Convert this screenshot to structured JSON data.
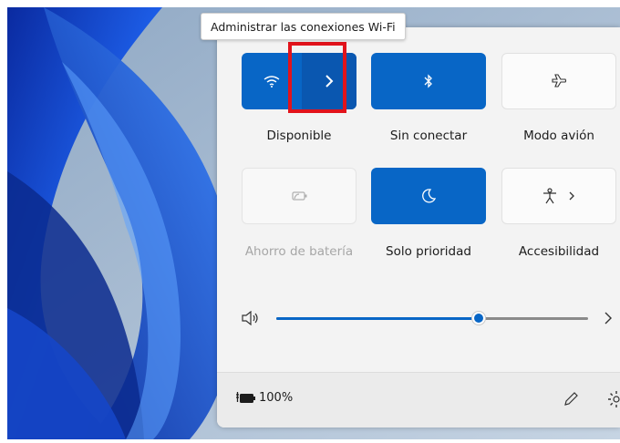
{
  "tooltip": {
    "text": "Administrar las conexiones Wi-Fi"
  },
  "tiles": {
    "wifi": {
      "label": "Disponible",
      "icon": "wifi-icon",
      "active": true
    },
    "wifi_manage": {
      "icon": "chevron-right-icon"
    },
    "bluetooth": {
      "label": "Sin conectar",
      "icon": "bluetooth-icon",
      "active": true
    },
    "airplane": {
      "label": "Modo avión",
      "icon": "airplane-icon",
      "active": false
    },
    "battery_saver": {
      "label": "Ahorro de batería",
      "icon": "battery-saver-icon",
      "enabled": false
    },
    "focus": {
      "label": "Solo prioridad",
      "icon": "moon-icon",
      "active": true
    },
    "accessibility": {
      "label": "Accesibilidad",
      "icon": "accessibility-icon",
      "has_chevron": true
    }
  },
  "volume": {
    "icon": "speaker-icon",
    "level": 0.65,
    "chevron_icon": "chevron-right-icon"
  },
  "footer": {
    "battery_icon": "battery-charging-icon",
    "battery_text": "100%",
    "edit_icon": "pencil-icon",
    "settings_icon": "gear-icon"
  },
  "colors": {
    "accent": "#0866c6",
    "accent_dark": "#0a57b0",
    "highlight": "#e2131b"
  }
}
